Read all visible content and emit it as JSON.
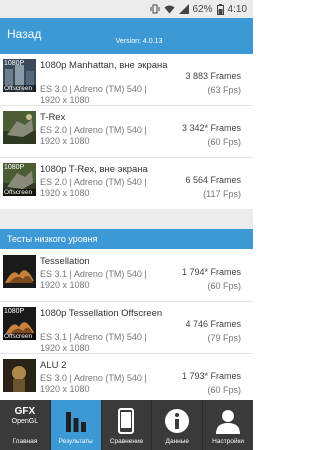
{
  "status": {
    "battery": "62%",
    "time": "4:10"
  },
  "header": {
    "title": "Назад",
    "version": "Version: 4.0.13"
  },
  "tests": [
    {
      "thumb_label": "1080P",
      "thumb_badge": "Offscreen",
      "name": "1080p Manhattan, вне экрана",
      "api": "ES 3.0 | Adreno (TM) 540 |",
      "resolution": "1920 x 1080",
      "frames": "3 883 Frames",
      "fps": "(63 Fps)"
    },
    {
      "thumb_label": "",
      "thumb_badge": "",
      "name": "T-Rex",
      "api": "ES 2.0 | Adreno (TM) 540 |",
      "resolution": "1920 x 1080",
      "frames": "3 342* Frames",
      "fps": "(60 Fps)"
    },
    {
      "thumb_label": "1080P",
      "thumb_badge": "Offscreen",
      "name": "1080p T-Rex, вне экрана",
      "api": "ES 2.0 | Adreno (TM) 540 |",
      "resolution": "1920 x 1080",
      "frames": "6 564 Frames",
      "fps": "(117 Fps)"
    }
  ],
  "section": {
    "title": "Тесты низкого уровня"
  },
  "low_level_tests": [
    {
      "thumb_label": "",
      "thumb_badge": "",
      "name": "Tessellation",
      "api": "ES 3.1 | Adreno (TM) 540 |",
      "resolution": "1920 x 1080",
      "frames": "1 794* Frames",
      "fps": "(60 Fps)"
    },
    {
      "thumb_label": "1080P",
      "thumb_badge": "Offscreen",
      "name": "1080p Tessellation Offscreen",
      "api": "ES 3.1 | Adreno (TM) 540 |",
      "resolution": "1920 x 1080",
      "frames": "4 746 Frames",
      "fps": "(79 Fps)"
    },
    {
      "thumb_label": "",
      "thumb_badge": "",
      "name": "ALU 2",
      "api": "ES 3.0 | Adreno (TM) 540 |",
      "resolution": "1920 x 1080",
      "frames": "1 793* Frames",
      "fps": "(60 Fps)"
    }
  ],
  "nav": [
    {
      "label": "Главная",
      "icon": "gfx-logo",
      "logo_line1": "GFX",
      "logo_line2": "OpenGL"
    },
    {
      "label": "Результаты",
      "icon": "bar-chart-icon",
      "active": true
    },
    {
      "label": "Сравнение",
      "icon": "phone-icon"
    },
    {
      "label": "Данные",
      "icon": "info-icon"
    },
    {
      "label": "Настройки",
      "icon": "user-icon"
    }
  ],
  "colors": {
    "accent": "#3d99d6",
    "nav_bg": "#3a3a3a"
  }
}
